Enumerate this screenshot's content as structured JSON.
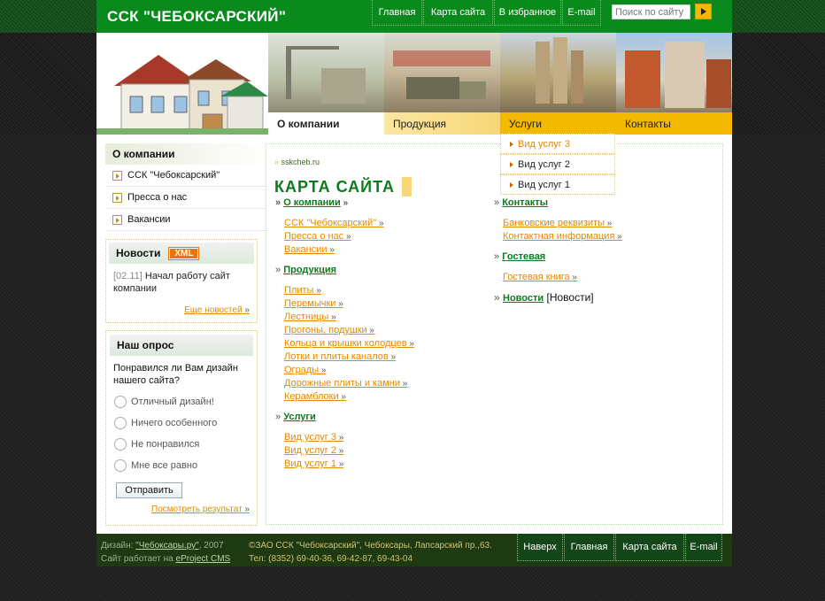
{
  "site": {
    "title": "ССК \"ЧЕБОКСАРСКИЙ\""
  },
  "topnav": [
    "Главная",
    "Карта сайта",
    "В избранное",
    "E-mail"
  ],
  "search": {
    "placeholder": "Поиск по сайту"
  },
  "menu": [
    "О компании",
    "Продукция",
    "Услуги",
    "Контакты"
  ],
  "dropdown": [
    "Вид услуг 3",
    "Вид услуг 2",
    "Вид услуг 1"
  ],
  "sidebar": {
    "about": {
      "title": "О компании",
      "items": [
        "ССК \"Чебоксарский\"",
        "Пресса о нас",
        "Вакансии"
      ]
    },
    "news": {
      "title": "Новости",
      "xml": "XML",
      "date": "[02.11]",
      "text": "Начал работу сайт компании",
      "more": "Еще новостей"
    },
    "poll": {
      "title": "Наш опрос",
      "question": "Понравился ли Вам дизайн нашего сайта?",
      "options": [
        "Отличный дизайн!",
        "Ничего особенного",
        "Не понравился",
        "Мне все равно"
      ],
      "submit": "Отправить",
      "results": "Посмотреть результат"
    }
  },
  "content": {
    "breadcrumb": "sskcheb.ru",
    "heading": "КАРТА САЙТА",
    "col1": [
      {
        "title": "О компании",
        "items": [
          "ССК \"Чебоксарский\"",
          "Пресса о нас",
          "Вакансии"
        ]
      },
      {
        "title": "Продукция",
        "items": [
          "Плиты",
          "Перемычки",
          "Лестницы",
          "Прогоны, подушки",
          "Кольца и крышки колодцев",
          "Лотки и плиты каналов",
          "Ограды",
          "Дорожные плиты и камни",
          "Керамблоки"
        ]
      },
      {
        "title": "Услуги",
        "items": [
          "Вид услуг 3",
          "Вид услуг 2",
          "Вид услуг 1"
        ]
      }
    ],
    "col2": [
      {
        "title": "Контакты",
        "items": [
          "Банковские реквизиты",
          "Контактная информация"
        ]
      },
      {
        "title": "Гостевая",
        "items": [
          "Гостевая книга"
        ]
      },
      {
        "title": "Новости",
        "suffix": "[Новости]",
        "items": []
      }
    ]
  },
  "footer": {
    "design_prefix": "Дизайн: ",
    "design_link": "\"Чебоксары.ру\"",
    "design_year": ", 2007",
    "cms_prefix": "Сайт работает на ",
    "cms_link": "eProject CMS",
    "copyright": "©ЗАО ССК \"Чебоксарский\", Чебоксары, Лапсарский пр.,63.",
    "phones": "Тел: (8352) 69-40-36, 69-42-87, 69-43-04",
    "nav": [
      "Наверх",
      "Главная",
      "Карта сайта",
      "E-mail"
    ]
  },
  "colors": {
    "green": "#0a8a1c",
    "orange": "#f3b800",
    "link": "#e28a00"
  }
}
